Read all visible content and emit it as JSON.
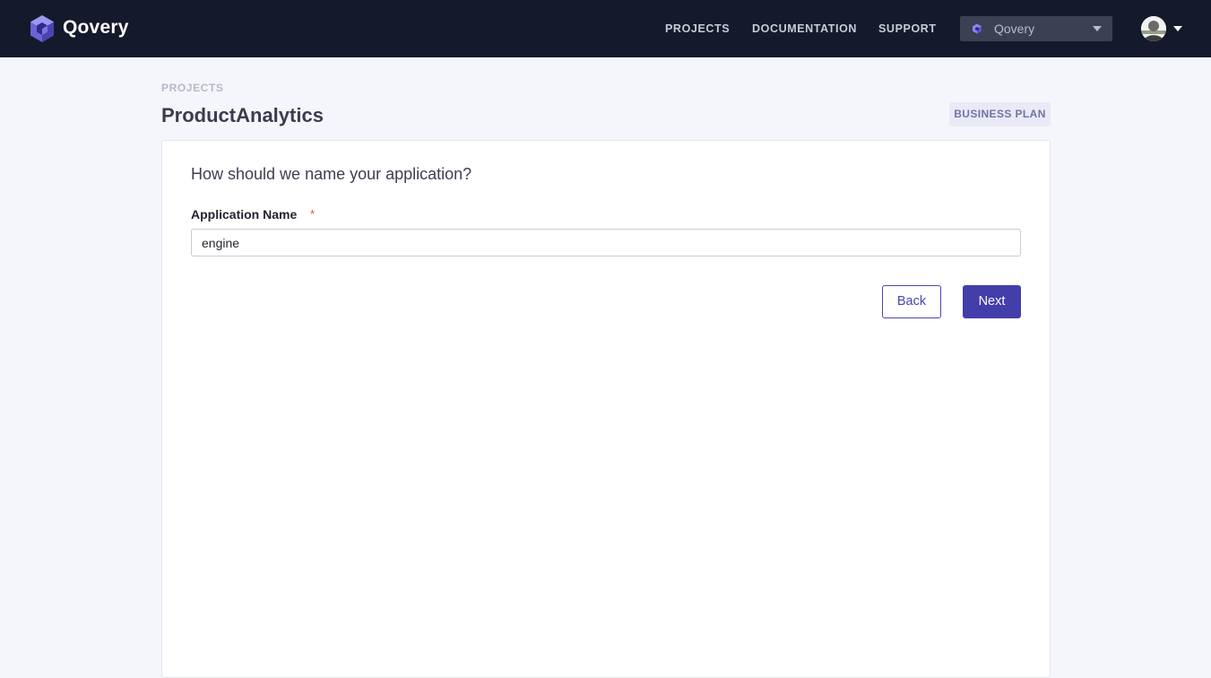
{
  "brand": {
    "name": "Qovery"
  },
  "nav": {
    "projects": "PROJECTS",
    "documentation": "DOCUMENTATION",
    "support": "SUPPORT"
  },
  "org_selector": {
    "selected": "Qovery"
  },
  "breadcrumb": "PROJECTS",
  "page": {
    "title": "ProductAnalytics",
    "plan_badge": "BUSINESS PLAN"
  },
  "form": {
    "question": "How should we name your application?",
    "field_label": "Application Name",
    "required_marker": "*",
    "input_value": "engine",
    "back_label": "Back",
    "next_label": "Next"
  },
  "colors": {
    "topbar": "#141a2b",
    "accent": "#433eaa",
    "required": "#e0524a",
    "background": "#f5f6fb"
  }
}
